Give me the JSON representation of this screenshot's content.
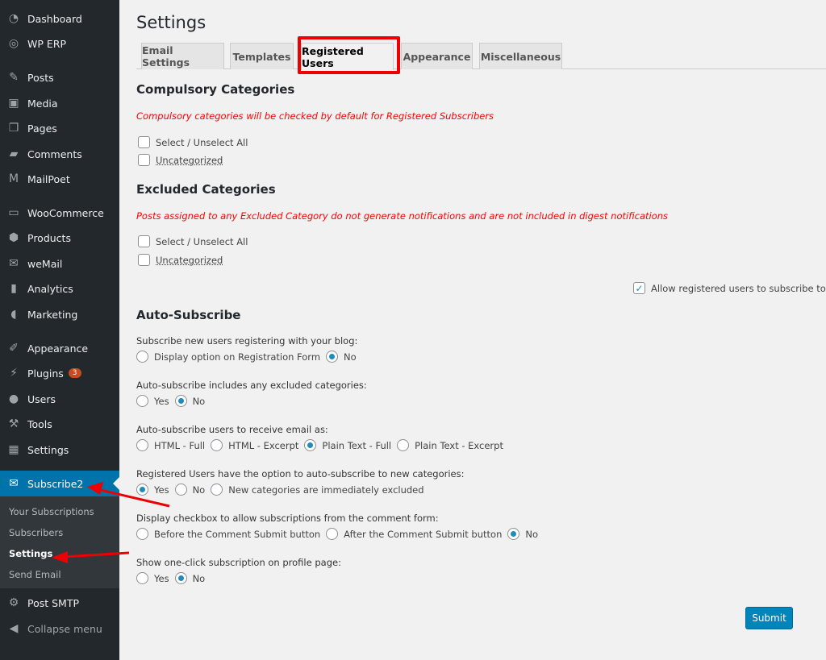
{
  "sidebar": {
    "items": [
      {
        "label": "Dashboard",
        "icon": "dashboard-icon"
      },
      {
        "label": "WP ERP",
        "icon": "erp-icon"
      },
      {
        "label": "Posts",
        "icon": "pin-icon"
      },
      {
        "label": "Media",
        "icon": "media-icon"
      },
      {
        "label": "Pages",
        "icon": "pages-icon"
      },
      {
        "label": "Comments",
        "icon": "comment-icon"
      },
      {
        "label": "MailPoet",
        "icon": "mailpoet-icon"
      },
      {
        "label": "WooCommerce",
        "icon": "woo-icon"
      },
      {
        "label": "Products",
        "icon": "box-icon"
      },
      {
        "label": "weMail",
        "icon": "envelope-icon"
      },
      {
        "label": "Analytics",
        "icon": "bar-chart-icon"
      },
      {
        "label": "Marketing",
        "icon": "megaphone-icon"
      },
      {
        "label": "Appearance",
        "icon": "brush-icon"
      },
      {
        "label": "Plugins",
        "icon": "plug-icon",
        "badge": "3"
      },
      {
        "label": "Users",
        "icon": "user-icon"
      },
      {
        "label": "Tools",
        "icon": "wrench-icon"
      },
      {
        "label": "Settings",
        "icon": "sliders-icon"
      },
      {
        "label": "Subscribe2",
        "icon": "subscribe-icon"
      },
      {
        "label": "Post SMTP",
        "icon": "gear-icon"
      },
      {
        "label": "Collapse menu",
        "icon": "collapse-icon"
      }
    ],
    "submenu": [
      "Your Subscriptions",
      "Subscribers",
      "Settings",
      "Send Email"
    ]
  },
  "page": {
    "title": "Settings"
  },
  "tabs": [
    "Email Settings",
    "Templates",
    "Registered Users",
    "Appearance",
    "Miscellaneous"
  ],
  "active_tab": "Registered Users",
  "compulsory": {
    "heading": "Compulsory Categories",
    "note": "Compulsory categories will be checked by default for Registered Subscribers",
    "select_all": "Select / Unselect All",
    "cat": "Uncategorized"
  },
  "excluded": {
    "heading": "Excluded Categories",
    "note": "Posts assigned to any Excluded Category do not generate notifications and are not included in digest notifications",
    "select_all": "Select / Unselect All",
    "cat": "Uncategorized",
    "allow_label": "Allow registered users to subscribe to exc",
    "allow_checked": true
  },
  "auto": {
    "heading": "Auto-Subscribe",
    "questions": [
      {
        "q": "Subscribe new users registering with your blog:",
        "options": [
          "Display option on Registration Form",
          "No"
        ],
        "selected": 1
      },
      {
        "q": "Auto-subscribe includes any excluded categories:",
        "options": [
          "Yes",
          "No"
        ],
        "selected": 1
      },
      {
        "q": "Auto-subscribe users to receive email as:",
        "options": [
          "HTML - Full",
          "HTML - Excerpt",
          "Plain Text - Full",
          "Plain Text - Excerpt"
        ],
        "selected": 2
      },
      {
        "q": "Registered Users have the option to auto-subscribe to new categories:",
        "options": [
          "Yes",
          "No",
          "New categories are immediately excluded"
        ],
        "selected": 0
      },
      {
        "q": "Display checkbox to allow subscriptions from the comment form:",
        "options": [
          "Before the Comment Submit button",
          "After the Comment Submit button",
          "No"
        ],
        "selected": 2
      },
      {
        "q": "Show one-click subscription on profile page:",
        "options": [
          "Yes",
          "No"
        ],
        "selected": 1
      }
    ]
  },
  "submit_label": "Submit",
  "colors": {
    "sidebar": "#23282d",
    "accent": "#0073aa",
    "warning": "#ff0000",
    "highlight": "#e00000"
  }
}
